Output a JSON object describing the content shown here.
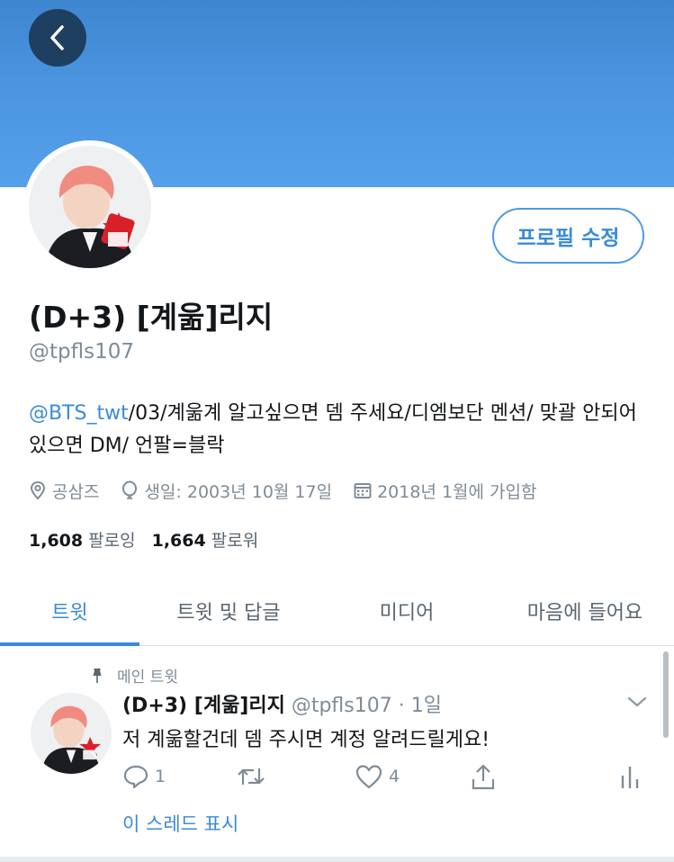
{
  "nav": {
    "back_icon": "chevron-left-icon"
  },
  "profile": {
    "name": "(D+3) [계욺]리지",
    "handle": "@tpfls107",
    "edit_button": "프로필 수정",
    "bio_mention": "@BTS_twt",
    "bio_text": "/03/계욺계 알고싶으면 뎀 주세요/디엠보단 멘션/ 맞괄 안되어 있으면 DM/ 언팔=블락",
    "location": "공삼즈",
    "birthday": "생일: 2003년 10월 17일",
    "joined": "2018년 1월에 가입함",
    "following_count": "1,608",
    "following_label": "팔로잉",
    "followers_count": "1,664",
    "followers_label": "팔로워"
  },
  "tabs": [
    {
      "label": "트윗",
      "active": true
    },
    {
      "label": "트윗 및 답글",
      "active": false
    },
    {
      "label": "미디어",
      "active": false
    },
    {
      "label": "마음에 들어요",
      "active": false
    }
  ],
  "tweet": {
    "pinned_label": "메인 트윗",
    "name": "(D+3) [계욺]리지",
    "handle_time": "@tpfls107 · 1일",
    "text": "저 계욺할건데 뎀 주시면 계정 알려드릴게요!",
    "reply_count": "1",
    "retweet_count": "",
    "like_count": "4",
    "thread_link": "이 스레드 표시"
  },
  "colors": {
    "accent": "#3a8bd9",
    "banner": "#4d97e2",
    "muted": "#7f8b96"
  }
}
